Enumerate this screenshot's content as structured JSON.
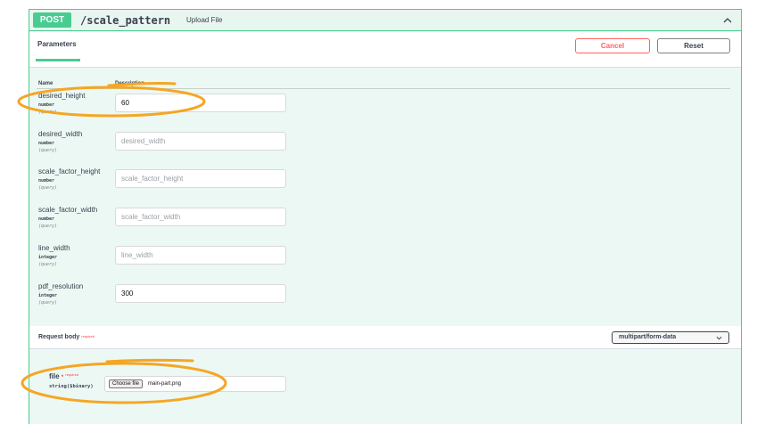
{
  "summary": {
    "method": "POST",
    "path": "/scale_pattern",
    "description": "Upload File"
  },
  "parameters_tab": {
    "label": "Parameters",
    "cancel_label": "Cancel",
    "reset_label": "Reset"
  },
  "columns": {
    "name": "Name",
    "description": "Description"
  },
  "params": [
    {
      "name": "desired_height",
      "type": "number",
      "in": "(query)",
      "value": "60",
      "placeholder": "desired_height"
    },
    {
      "name": "desired_width",
      "type": "number",
      "in": "(query)",
      "value": "",
      "placeholder": "desired_width"
    },
    {
      "name": "scale_factor_height",
      "type": "number",
      "in": "(query)",
      "value": "",
      "placeholder": "scale_factor_height"
    },
    {
      "name": "scale_factor_width",
      "type": "number",
      "in": "(query)",
      "value": "",
      "placeholder": "scale_factor_width"
    },
    {
      "name": "line_width",
      "type": "integer",
      "in": "(query)",
      "value": "",
      "placeholder": "line_width"
    },
    {
      "name": "pdf_resolution",
      "type": "integer",
      "in": "(query)",
      "value": "300",
      "placeholder": "pdf_resolution"
    }
  ],
  "request_body": {
    "title": "Request body",
    "required_label": "required",
    "content_type": "multipart/form-data"
  },
  "file_param": {
    "name": "file",
    "star": "*",
    "required_label": "required",
    "type": "string($binary)",
    "choose_label": "Choose file",
    "chosen_file": "main-part.png"
  },
  "colors": {
    "post_green": "#49cc90",
    "panel_bg": "#ecf8f3",
    "cancel_red": "#ff6060",
    "annotation_orange": "#f5a623"
  }
}
